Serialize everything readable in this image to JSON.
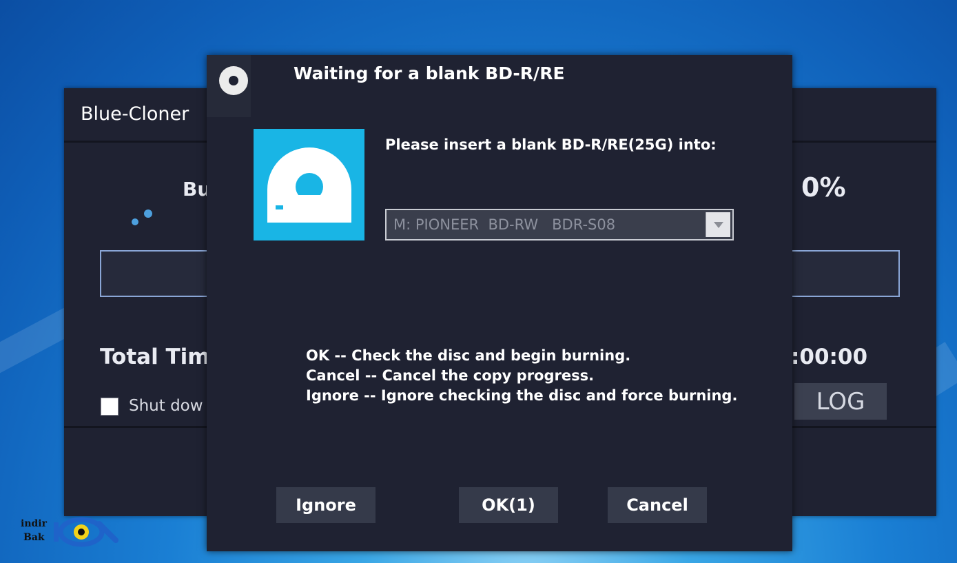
{
  "background_window": {
    "title": "Blue-Cloner",
    "burn_label": "Bu",
    "percent": "0%",
    "total_time_label": "Total Tim",
    "time_value": ":00:00",
    "shutdown_label": "Shut dow",
    "shutdown_checked": false,
    "log_button": "LOG"
  },
  "dialog": {
    "title": "Waiting for a blank BD-R/RE",
    "prompt": "Please insert a blank BD-R/RE(25G) into:",
    "drive_select": {
      "value": "M: PIONEER  BD-RW   BDR-S08"
    },
    "instructions": [
      "OK -- Check the disc and begin burning.",
      "Cancel -- Cancel the copy progress.",
      "Ignore -- Ignore checking the disc and force burning."
    ],
    "buttons": {
      "ignore": "Ignore",
      "ok": "OK(1)",
      "cancel": "Cancel"
    }
  },
  "watermark": {
    "line1": "indir",
    "line2": "Bak"
  },
  "colors": {
    "window_bg": "#1f2232",
    "button_bg": "#353a4a",
    "accent": "#19b5e5"
  }
}
